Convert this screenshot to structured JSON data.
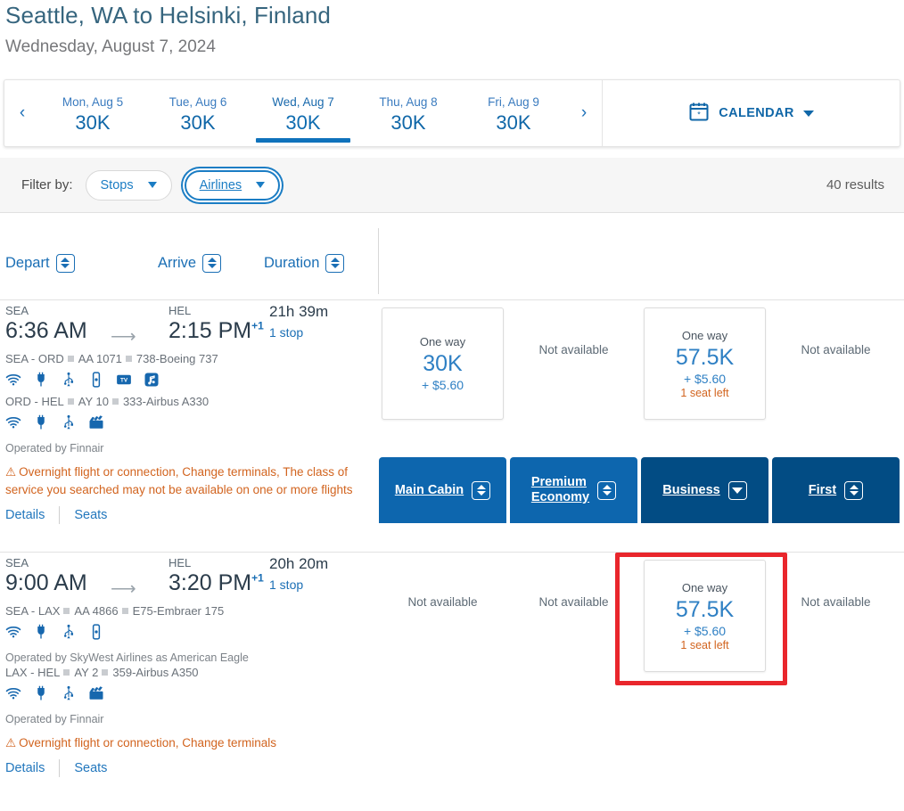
{
  "header": {
    "route_title": "Seattle, WA to Helsinki, Finland",
    "date_subtitle": "Wednesday, August 7, 2024"
  },
  "date_strip": {
    "prev_arrow": "‹",
    "next_arrow": "›",
    "calendar_label": "CALENDAR",
    "calendar_icon": "calendar-icon",
    "tabs": [
      {
        "label": "Mon, Aug 5",
        "value": "30K",
        "active": false
      },
      {
        "label": "Tue, Aug 6",
        "value": "30K",
        "active": false
      },
      {
        "label": "Wed, Aug 7",
        "value": "30K",
        "active": true
      },
      {
        "label": "Thu, Aug 8",
        "value": "30K",
        "active": false
      },
      {
        "label": "Fri, Aug 9",
        "value": "30K",
        "active": false
      }
    ]
  },
  "filter_bar": {
    "label": "Filter by:",
    "filters": [
      {
        "label": "Stops",
        "focused": false
      },
      {
        "label": "Airlines",
        "focused": true
      }
    ],
    "results_count": "40 results"
  },
  "columns": {
    "sortable": [
      {
        "label": "Depart",
        "sort_icon": "sort-updown-icon"
      },
      {
        "label": "Arrive",
        "sort_icon": "sort-updown-icon"
      },
      {
        "label": "Duration",
        "sort_icon": "sort-updown-icon"
      }
    ],
    "cabins": [
      {
        "label": "Main Cabin",
        "style": "light",
        "sort_icon": "sort-updown-icon"
      },
      {
        "label": "Premium Economy",
        "line1": "Premium",
        "line2": "Economy",
        "style": "light",
        "sort_icon": "sort-updown-icon"
      },
      {
        "label": "Business",
        "style": "dark",
        "sort_icon": "sort-down-icon"
      },
      {
        "label": "First",
        "style": "dark",
        "sort_icon": "sort-updown-icon"
      }
    ]
  },
  "flights": [
    {
      "depart_code": "SEA",
      "depart_time": "6:36 AM",
      "arrive_code": "HEL",
      "arrive_time": "2:15 PM",
      "arrive_day_offset": "+1",
      "duration": "21h 39m",
      "stops": "1 stop",
      "segments": [
        {
          "route": "SEA - ORD",
          "flight_no": "AA 1071",
          "aircraft": "738-Boeing 737",
          "amenities": [
            "wifi-icon",
            "power-icon",
            "usb-icon",
            "device-icon",
            "tv-icon",
            "music-icon"
          ],
          "operated_by": ""
        },
        {
          "route": "ORD - HEL",
          "flight_no": "AY 10",
          "aircraft": "333-Airbus A330",
          "amenities": [
            "wifi-icon",
            "power-icon",
            "usb-icon",
            "movie-icon"
          ],
          "operated_by": "Operated by Finnair"
        }
      ],
      "warning": "Overnight flight or connection, Change terminals, The class of service you searched may not be available on one or more flights",
      "links": {
        "details": "Details",
        "seats": "Seats"
      },
      "fares": [
        {
          "available": true,
          "one_way": "One way",
          "miles": "30K",
          "tax": "+ $5.60",
          "seats_left": ""
        },
        {
          "available": false,
          "not_available": "Not available"
        },
        {
          "available": true,
          "one_way": "One way",
          "miles": "57.5K",
          "tax": "+ $5.60",
          "seats_left": "1 seat left"
        },
        {
          "available": false,
          "not_available": "Not available"
        }
      ]
    },
    {
      "depart_code": "SEA",
      "depart_time": "9:00 AM",
      "arrive_code": "HEL",
      "arrive_time": "3:20 PM",
      "arrive_day_offset": "+1",
      "duration": "20h 20m",
      "stops": "1 stop",
      "segments": [
        {
          "route": "SEA - LAX",
          "flight_no": "AA 4866",
          "aircraft": "E75-Embraer 175",
          "amenities": [
            "wifi-icon",
            "power-icon",
            "usb-icon",
            "device-icon"
          ],
          "operated_by": "Operated by SkyWest Airlines as American Eagle"
        },
        {
          "route": "LAX - HEL",
          "flight_no": "AY 2",
          "aircraft": "359-Airbus A350",
          "amenities": [
            "wifi-icon",
            "power-icon",
            "usb-icon",
            "movie-icon"
          ],
          "operated_by": "Operated by Finnair"
        }
      ],
      "warning": "Overnight flight or connection, Change terminals",
      "links": {
        "details": "Details",
        "seats": "Seats"
      },
      "fares": [
        {
          "available": false,
          "not_available": "Not available"
        },
        {
          "available": false,
          "not_available": "Not available"
        },
        {
          "available": true,
          "one_way": "One way",
          "miles": "57.5K",
          "tax": "+ $5.60",
          "seats_left": "1 seat left",
          "highlighted": true
        },
        {
          "available": false,
          "not_available": "Not available"
        }
      ]
    }
  ],
  "annotation": {
    "highlight_color": "#e9262c",
    "target": "business-fare-row-2"
  }
}
